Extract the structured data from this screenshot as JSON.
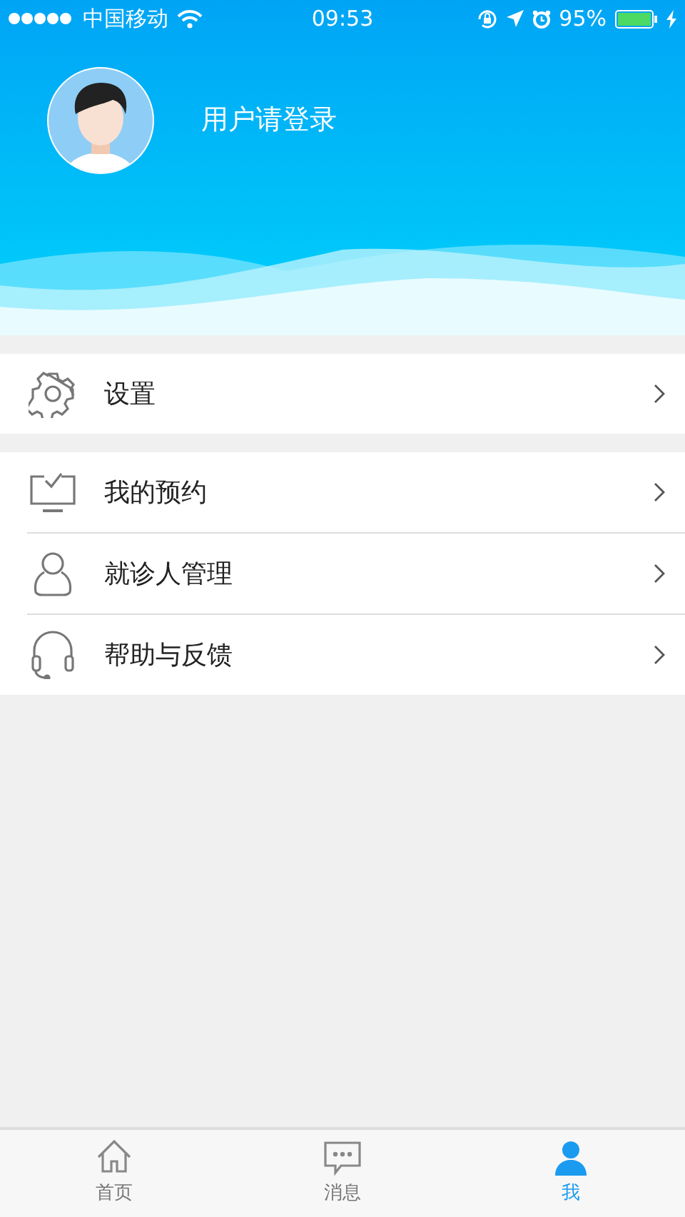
{
  "status_bar": {
    "carrier": "中国移动",
    "time": "09:53",
    "battery": "95%"
  },
  "profile": {
    "login_prompt": "用户请登录"
  },
  "menu_groups": [
    {
      "items": [
        {
          "kind": "gear",
          "label": "设置"
        }
      ]
    },
    {
      "items": [
        {
          "kind": "monitor",
          "label": "我的预约"
        },
        {
          "kind": "person",
          "label": "就诊人管理"
        },
        {
          "kind": "headset",
          "label": "帮助与反馈"
        }
      ]
    }
  ],
  "tab_bar": [
    {
      "kind": "home",
      "label": "首页",
      "selected": false
    },
    {
      "kind": "message",
      "label": "消息",
      "selected": false
    },
    {
      "kind": "person",
      "label": "我",
      "selected": true
    }
  ]
}
